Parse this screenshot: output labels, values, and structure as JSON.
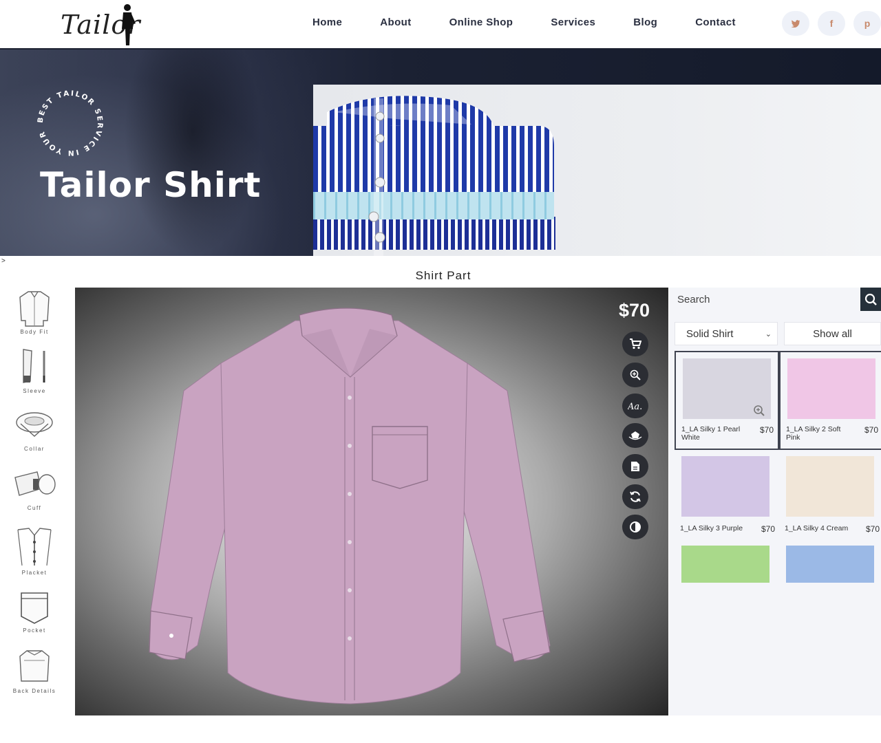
{
  "brand": {
    "logo_text": "Tailor"
  },
  "nav": {
    "items": [
      "Home",
      "About",
      "Online Shop",
      "Services",
      "Blog",
      "Contact"
    ]
  },
  "social": {
    "twitter": "t",
    "facebook": "f",
    "pinterest": "p"
  },
  "hero": {
    "badge_text": "BEST TAILOR SERVICE IN YOUR CITY",
    "title": "Tailor Shirt"
  },
  "stray_glyph": ">",
  "section_title": "Shirt Part",
  "tools": [
    {
      "label": "Body Fit",
      "icon": "body-fit-icon"
    },
    {
      "label": "Sleeve",
      "icon": "sleeve-icon"
    },
    {
      "label": "Collar",
      "icon": "collar-icon"
    },
    {
      "label": "Cuff",
      "icon": "cuff-icon"
    },
    {
      "label": "Placket",
      "icon": "placket-icon"
    },
    {
      "label": "Pocket",
      "icon": "pocket-icon"
    },
    {
      "label": "Back Details",
      "icon": "back-details-icon"
    }
  ],
  "canvas": {
    "price": "$70",
    "shirt_color": "#c9a3c1",
    "actions": [
      "cart-icon",
      "zoom-in-icon",
      "monogram-icon",
      "rotate-view-icon",
      "summary-icon",
      "reset-icon",
      "contrast-icon"
    ]
  },
  "fabric_panel": {
    "search_placeholder": "Search",
    "filter_selected": "Solid Shirt",
    "show_all": "Show all",
    "fabrics": [
      {
        "name": "1_LA Silky 1 Pearl White",
        "price": "$70",
        "color": "#d8d6e0",
        "selected": true
      },
      {
        "name": "1_LA Silky 2 Soft Pink",
        "price": "$70",
        "color": "#f0c6e6",
        "selected": true
      },
      {
        "name": "1_LA Silky 3 Purple",
        "price": "$70",
        "color": "#d3c6e6",
        "selected": false
      },
      {
        "name": "1_LA Silky 4 Cream",
        "price": "$70",
        "color": "#f1e6d8",
        "selected": false
      },
      {
        "name": "",
        "price": "",
        "color": "#a9d98a",
        "selected": false
      },
      {
        "name": "",
        "price": "",
        "color": "#9bb9e6",
        "selected": false
      }
    ]
  }
}
